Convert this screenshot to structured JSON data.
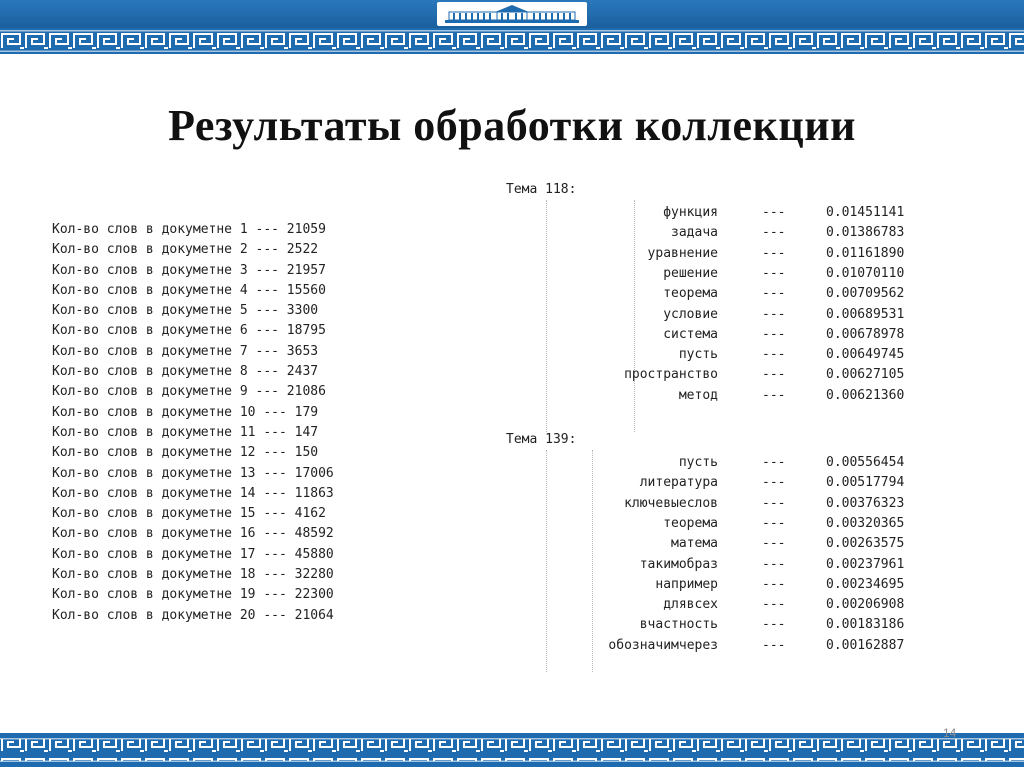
{
  "title": "Результаты обработки коллекции",
  "documents": [
    "Кол-во слов в докуметне 1 --- 21059",
    "Кол-во слов в докуметне 2 --- 2522",
    "Кол-во слов в докуметне 3 --- 21957",
    "Кол-во слов в докуметне 4 --- 15560",
    "Кол-во слов в докуметне 5 --- 3300",
    "Кол-во слов в докуметне 6 --- 18795",
    "Кол-во слов в докуметне 7 --- 3653",
    "Кол-во слов в докуметне 8 --- 2437",
    "Кол-во слов в докуметне 9 --- 21086",
    "Кол-во слов в докуметне 10 --- 179",
    "Кол-во слов в докуметне 11 --- 147",
    "Кол-во слов в докуметне 12 --- 150",
    "Кол-во слов в докуметне 13 --- 17006",
    "Кол-во слов в докуметне 14 --- 11863",
    "Кол-во слов в докуметне 15 --- 4162",
    "Кол-во слов в докуметне 16 --- 48592",
    "Кол-во слов в докуметне 17 --- 45880",
    "Кол-во слов в докуметне 18 --- 32280",
    "Кол-во слов в докуметне 19 --- 22300",
    "Кол-во слов в докуметне 20 --- 21064"
  ],
  "topics": [
    {
      "label": "Тема 118:",
      "terms": [
        {
          "word": "функция",
          "sep": "---",
          "value": "0.01451141"
        },
        {
          "word": "задача",
          "sep": "---",
          "value": "0.01386783"
        },
        {
          "word": "уравнение",
          "sep": "---",
          "value": "0.01161890"
        },
        {
          "word": "решение",
          "sep": "---",
          "value": "0.01070110"
        },
        {
          "word": "теорема",
          "sep": "---",
          "value": "0.00709562"
        },
        {
          "word": "условие",
          "sep": "---",
          "value": "0.00689531"
        },
        {
          "word": "система",
          "sep": "---",
          "value": "0.00678978"
        },
        {
          "word": "пусть",
          "sep": "---",
          "value": "0.00649745"
        },
        {
          "word": "пространство",
          "sep": "---",
          "value": "0.00627105"
        },
        {
          "word": "метод",
          "sep": "---",
          "value": "0.00621360"
        }
      ]
    },
    {
      "label": "Тема 139:",
      "terms": [
        {
          "word": "пусть",
          "sep": "---",
          "value": "0.00556454"
        },
        {
          "word": "литература",
          "sep": "---",
          "value": "0.00517794"
        },
        {
          "word": "ключевыеслов",
          "sep": "---",
          "value": "0.00376323"
        },
        {
          "word": "теорема",
          "sep": "---",
          "value": "0.00320365"
        },
        {
          "word": "матема",
          "sep": "---",
          "value": "0.00263575"
        },
        {
          "word": "такимобраз",
          "sep": "---",
          "value": "0.00237961"
        },
        {
          "word": "например",
          "sep": "---",
          "value": "0.00234695"
        },
        {
          "word": "длявсех",
          "sep": "---",
          "value": "0.00206908"
        },
        {
          "word": "вчастность",
          "sep": "---",
          "value": "0.00183186"
        },
        {
          "word": "обозначимчерез",
          "sep": "---",
          "value": "0.00162887"
        }
      ]
    }
  ],
  "page_number": "14",
  "colors": {
    "band": "#1e6bb0",
    "pattern": "#ffffff",
    "text": "#222222"
  }
}
